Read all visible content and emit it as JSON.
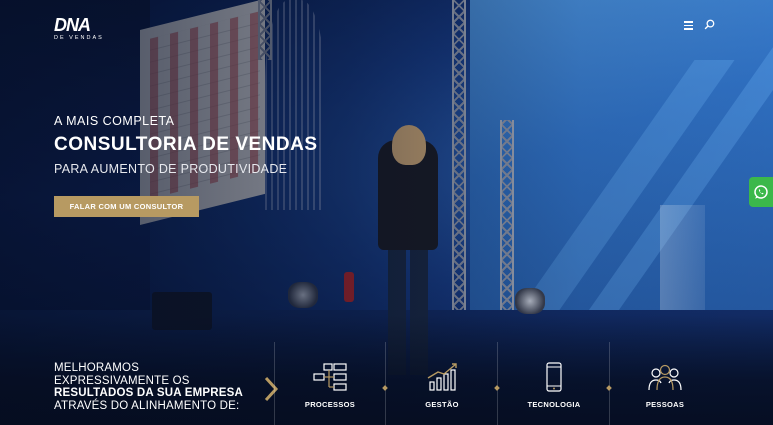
{
  "header": {
    "logo_main": "DNA",
    "logo_sub": "DE VENDAS"
  },
  "hero": {
    "kicker": "A MAIS COMPLETA",
    "title": "CONSULTORIA DE VENDAS",
    "subtitle": "PARA AUMENTO DE PRODUTIVIDADE",
    "cta_label": "FALAR COM UM CONSULTOR"
  },
  "band": {
    "line1": "MELHORAMOS",
    "line2": "EXPRESSIVAMENTE OS",
    "line3": "RESULTADOS DA SUA EMPRESA",
    "line4": "ATRAVÉS DO ALINHAMENTO DE:"
  },
  "pillars": [
    {
      "label": "PROCESSOS",
      "icon": "processes-icon"
    },
    {
      "label": "GESTÃO",
      "icon": "growth-chart-icon"
    },
    {
      "label": "TECNOLOGIA",
      "icon": "smartphone-icon"
    },
    {
      "label": "PESSOAS",
      "icon": "people-icon"
    }
  ],
  "colors": {
    "accent_gold": "#b79a62",
    "whatsapp_green": "#3bb84a",
    "text_white": "#ffffff"
  }
}
